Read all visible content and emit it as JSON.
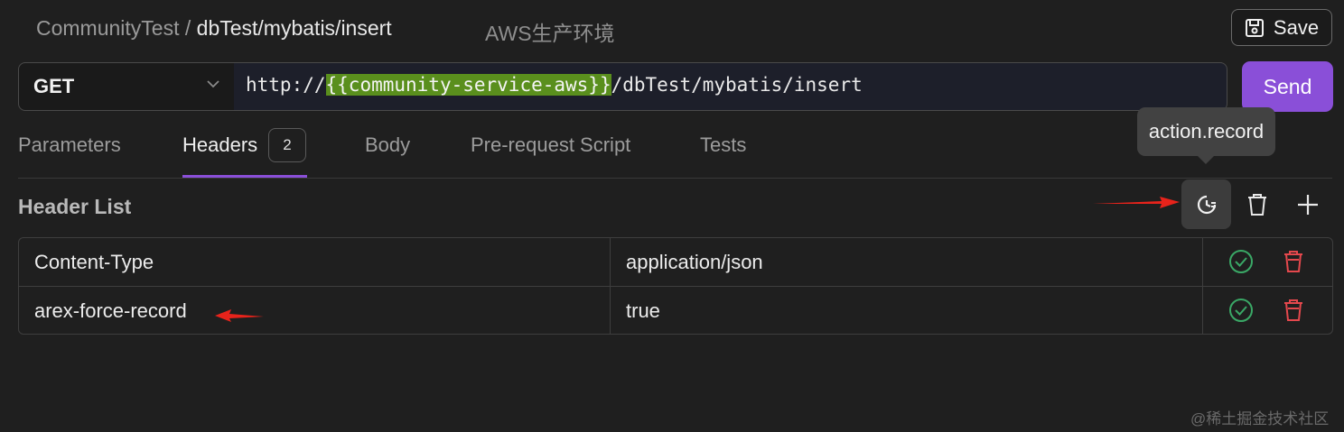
{
  "breadcrumb": {
    "collection": "CommunityTest",
    "separator": "/",
    "current": "dbTest/mybatis/insert"
  },
  "environment": "AWS生产环境",
  "save_button": {
    "label": "Save",
    "icon": "save-icon"
  },
  "request": {
    "method": "GET",
    "url_prefix": "http://",
    "url_variable": "{{community-service-aws}}",
    "url_suffix": "/dbTest/mybatis/insert",
    "send_label": "Send"
  },
  "tabs": [
    {
      "label": "Parameters",
      "active": false
    },
    {
      "label": "Headers",
      "active": true,
      "badge": "2"
    },
    {
      "label": "Body",
      "active": false
    },
    {
      "label": "Pre-request Script",
      "active": false
    },
    {
      "label": "Tests",
      "active": false
    }
  ],
  "tooltip": "action.record",
  "header_list": {
    "title": "Header List",
    "toolbar_icons": [
      "record-icon",
      "trash-icon",
      "plus-icon"
    ],
    "rows": [
      {
        "key": "Content-Type",
        "value": "application/json",
        "enabled": true
      },
      {
        "key": "arex-force-record",
        "value": "true",
        "enabled": true
      }
    ]
  },
  "watermark": "@稀土掘金技术社区",
  "colors": {
    "accent": "#8a4fd8",
    "variable_highlight": "#5a8f1d",
    "enabled_check": "#3aa866",
    "delete_red": "#e5484d",
    "annotation_arrow": "#e8231b"
  }
}
